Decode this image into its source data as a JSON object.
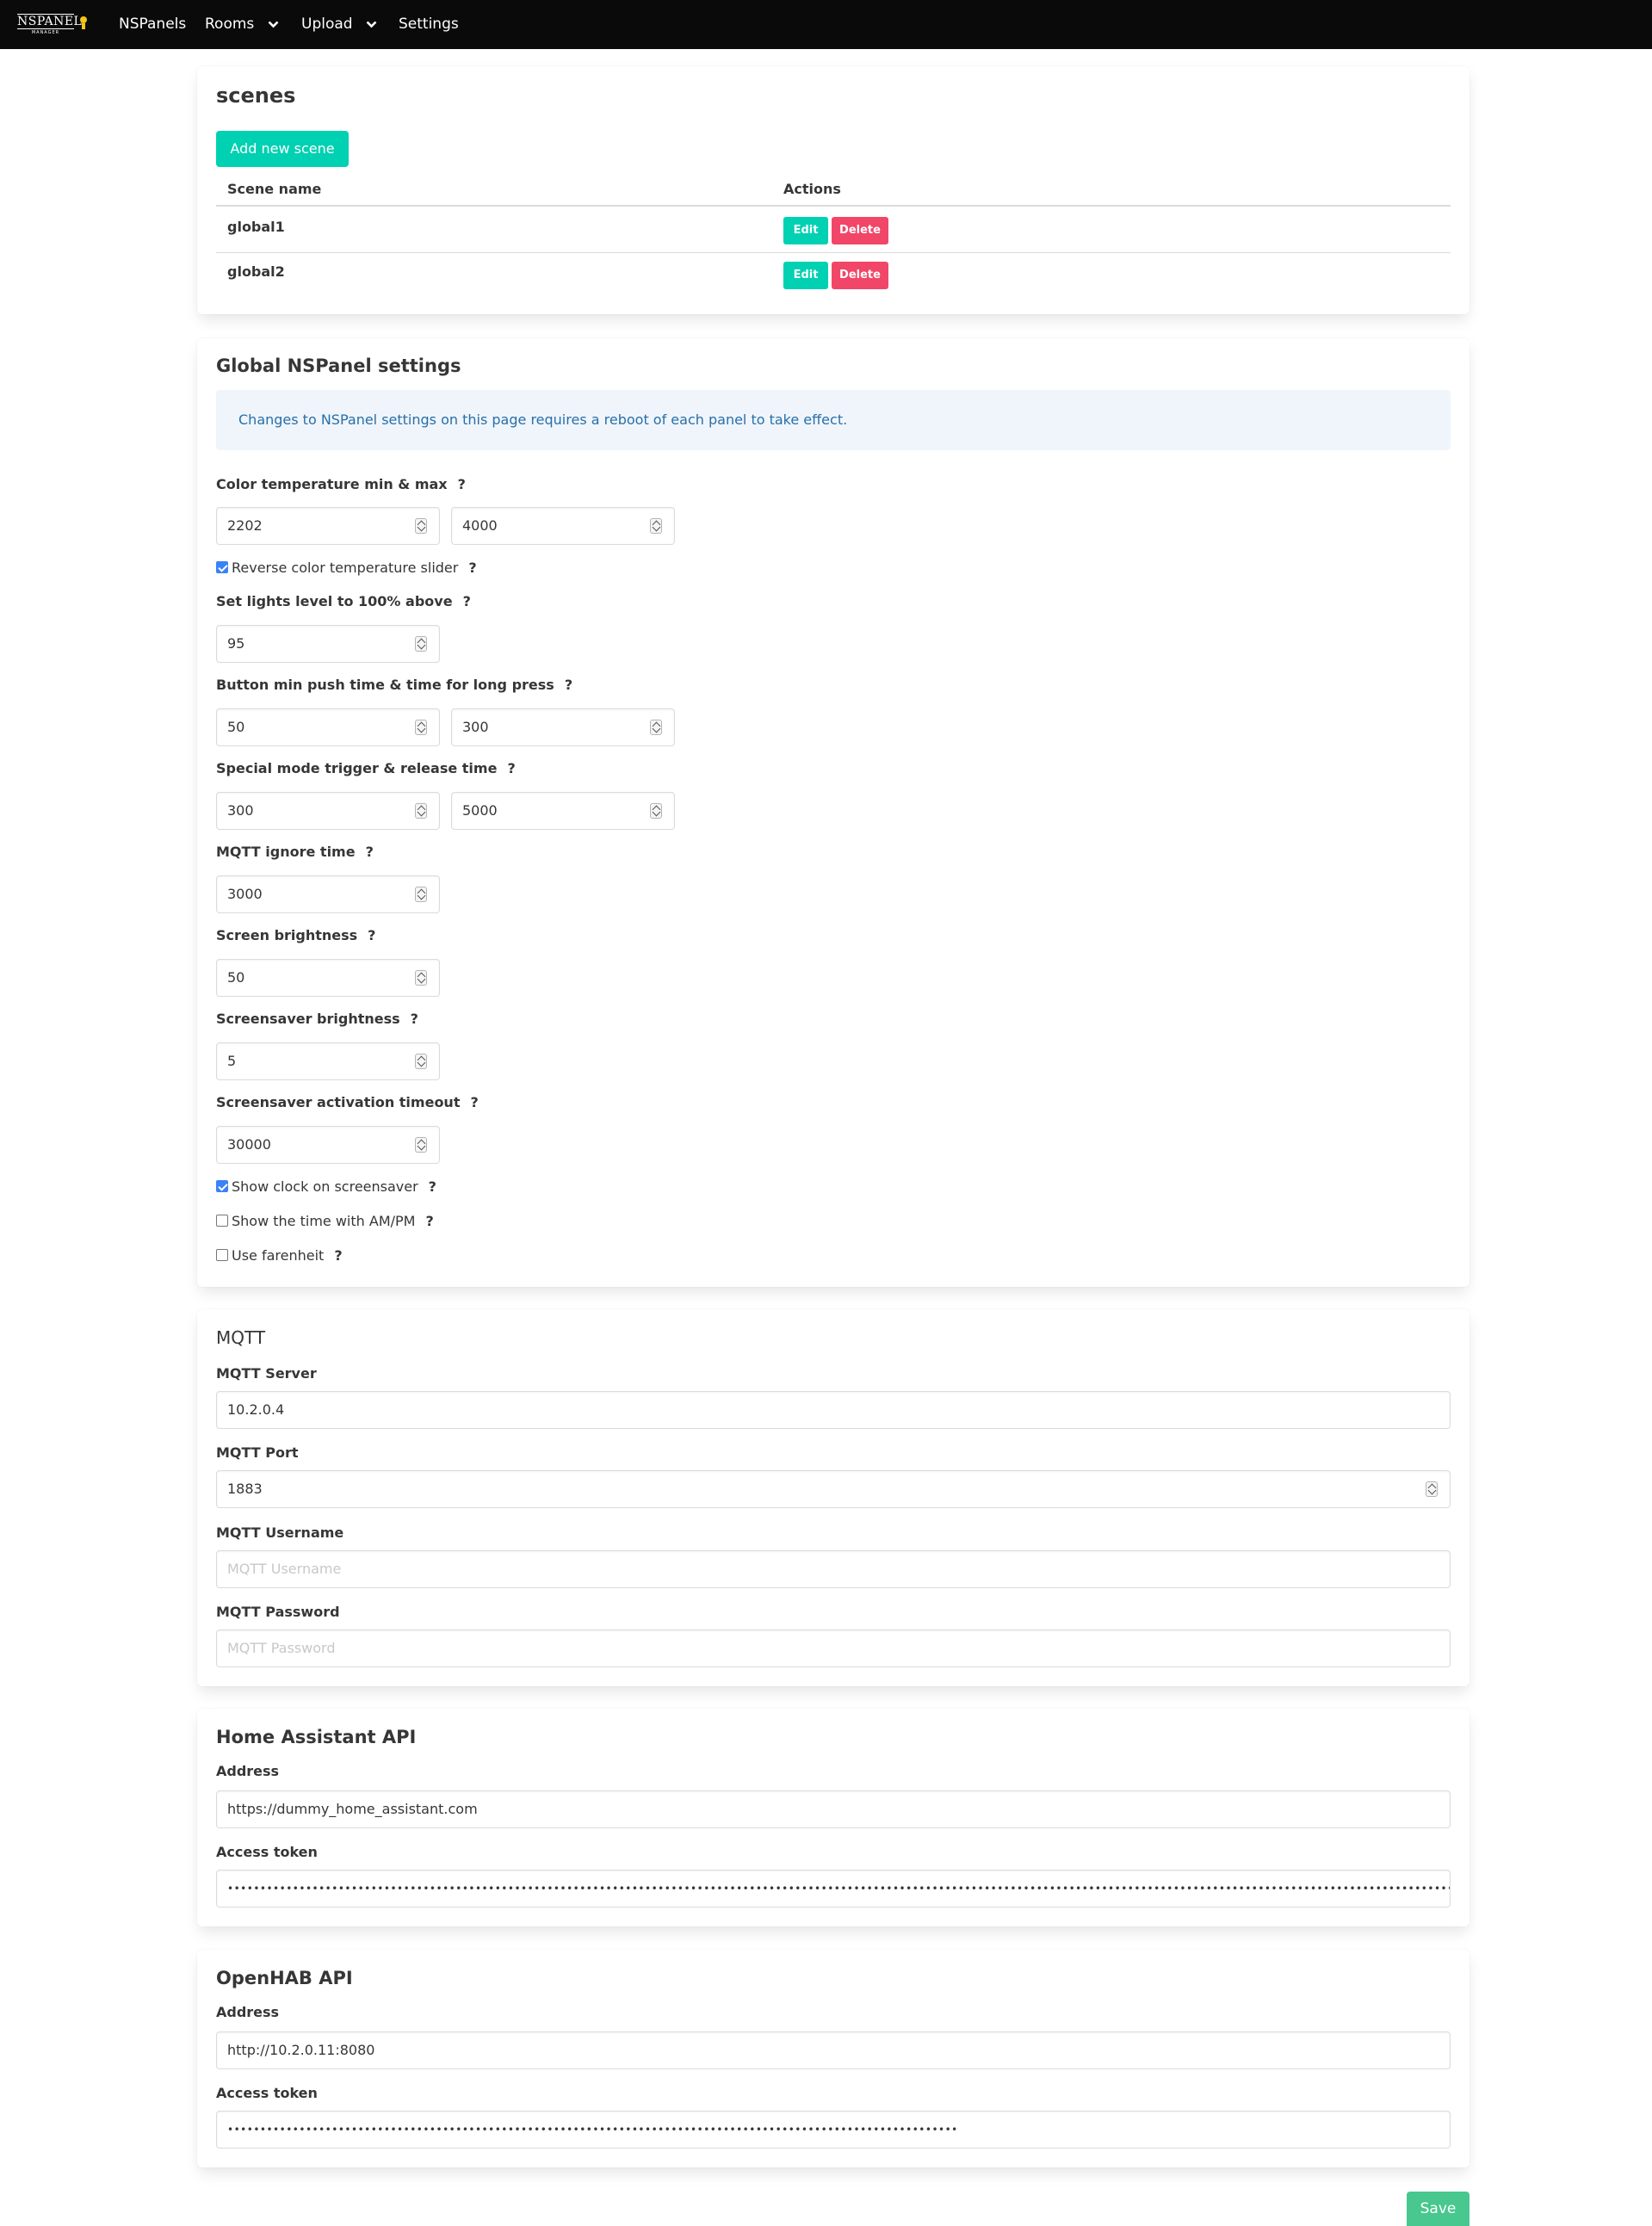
{
  "navbar": {
    "brand": "NSPANEL",
    "brand_sub": "MANAGER",
    "items": [
      {
        "label": "NSPanels"
      },
      {
        "label": "Rooms"
      },
      {
        "label": "Upload"
      },
      {
        "label": "Settings"
      }
    ]
  },
  "scenes": {
    "title": "scenes",
    "add_button": "Add new scene",
    "columns": [
      "Scene name",
      "Actions"
    ],
    "rows": [
      {
        "name": "global1",
        "edit": "Edit",
        "delete": "Delete"
      },
      {
        "name": "global2",
        "edit": "Edit",
        "delete": "Delete"
      }
    ]
  },
  "global": {
    "title": "Global NSPanel settings",
    "notice": "Changes to NSPanel settings on this page requires a reboot of each panel to take effect.",
    "help": "?",
    "color_temp": {
      "label": "Color temperature min & max",
      "min": "2202",
      "max": "4000"
    },
    "reverse_slider": {
      "label": "Reverse color temperature slider",
      "checked": true
    },
    "lights_level": {
      "label": "Set lights level to 100% above",
      "value": "95"
    },
    "button_push": {
      "label": "Button min push time & time for long press",
      "min": "50",
      "long": "300"
    },
    "special_mode": {
      "label": "Special mode trigger & release time",
      "trigger": "300",
      "release": "5000"
    },
    "mqtt_ignore": {
      "label": "MQTT ignore time",
      "value": "3000"
    },
    "screen_brightness": {
      "label": "Screen brightness",
      "value": "50"
    },
    "screensaver_brightness": {
      "label": "Screensaver brightness",
      "value": "5"
    },
    "screensaver_timeout": {
      "label": "Screensaver activation timeout",
      "value": "30000"
    },
    "show_clock": {
      "label": "Show clock on screensaver",
      "checked": true
    },
    "ampm": {
      "label": "Show the time with AM/PM",
      "checked": false
    },
    "farenheit": {
      "label": "Use farenheit",
      "checked": false
    }
  },
  "mqtt": {
    "title": "MQTT",
    "server_label": "MQTT Server",
    "server": "10.2.0.4",
    "port_label": "MQTT Port",
    "port": "1883",
    "username_label": "MQTT Username",
    "username_placeholder": "MQTT Username",
    "password_label": "MQTT Password",
    "password_placeholder": "MQTT Password"
  },
  "home_assistant": {
    "title": "Home Assistant API",
    "address_label": "Address",
    "address": "https://dummy_home_assistant.com",
    "token_label": "Access token",
    "token_mask": "•••••••••••••••••••••••••••••••••••••••••••••••••••••••••••••••••••••••••••••••••••••••••••••••••••••••••••••••••••••••••••••••••••••••••••••••••••••••••••••••••••••••••••••••••••••••••••••••"
  },
  "openhab": {
    "title": "OpenHAB API",
    "address_label": "Address",
    "address": "http://10.2.0.11:8080",
    "token_label": "Access token",
    "token_mask": "••••••••••••••••••••••••••••••••••••••••••••••••••••••••••••••••••••••••••••••••••••••••••••••••••••••••••••••••"
  },
  "save_button": "Save",
  "colors": {
    "primary": "#00d1b2",
    "danger": "#f14668",
    "success": "#48c78e",
    "info_bg": "#eff5fb",
    "info_text": "#296fa8"
  }
}
